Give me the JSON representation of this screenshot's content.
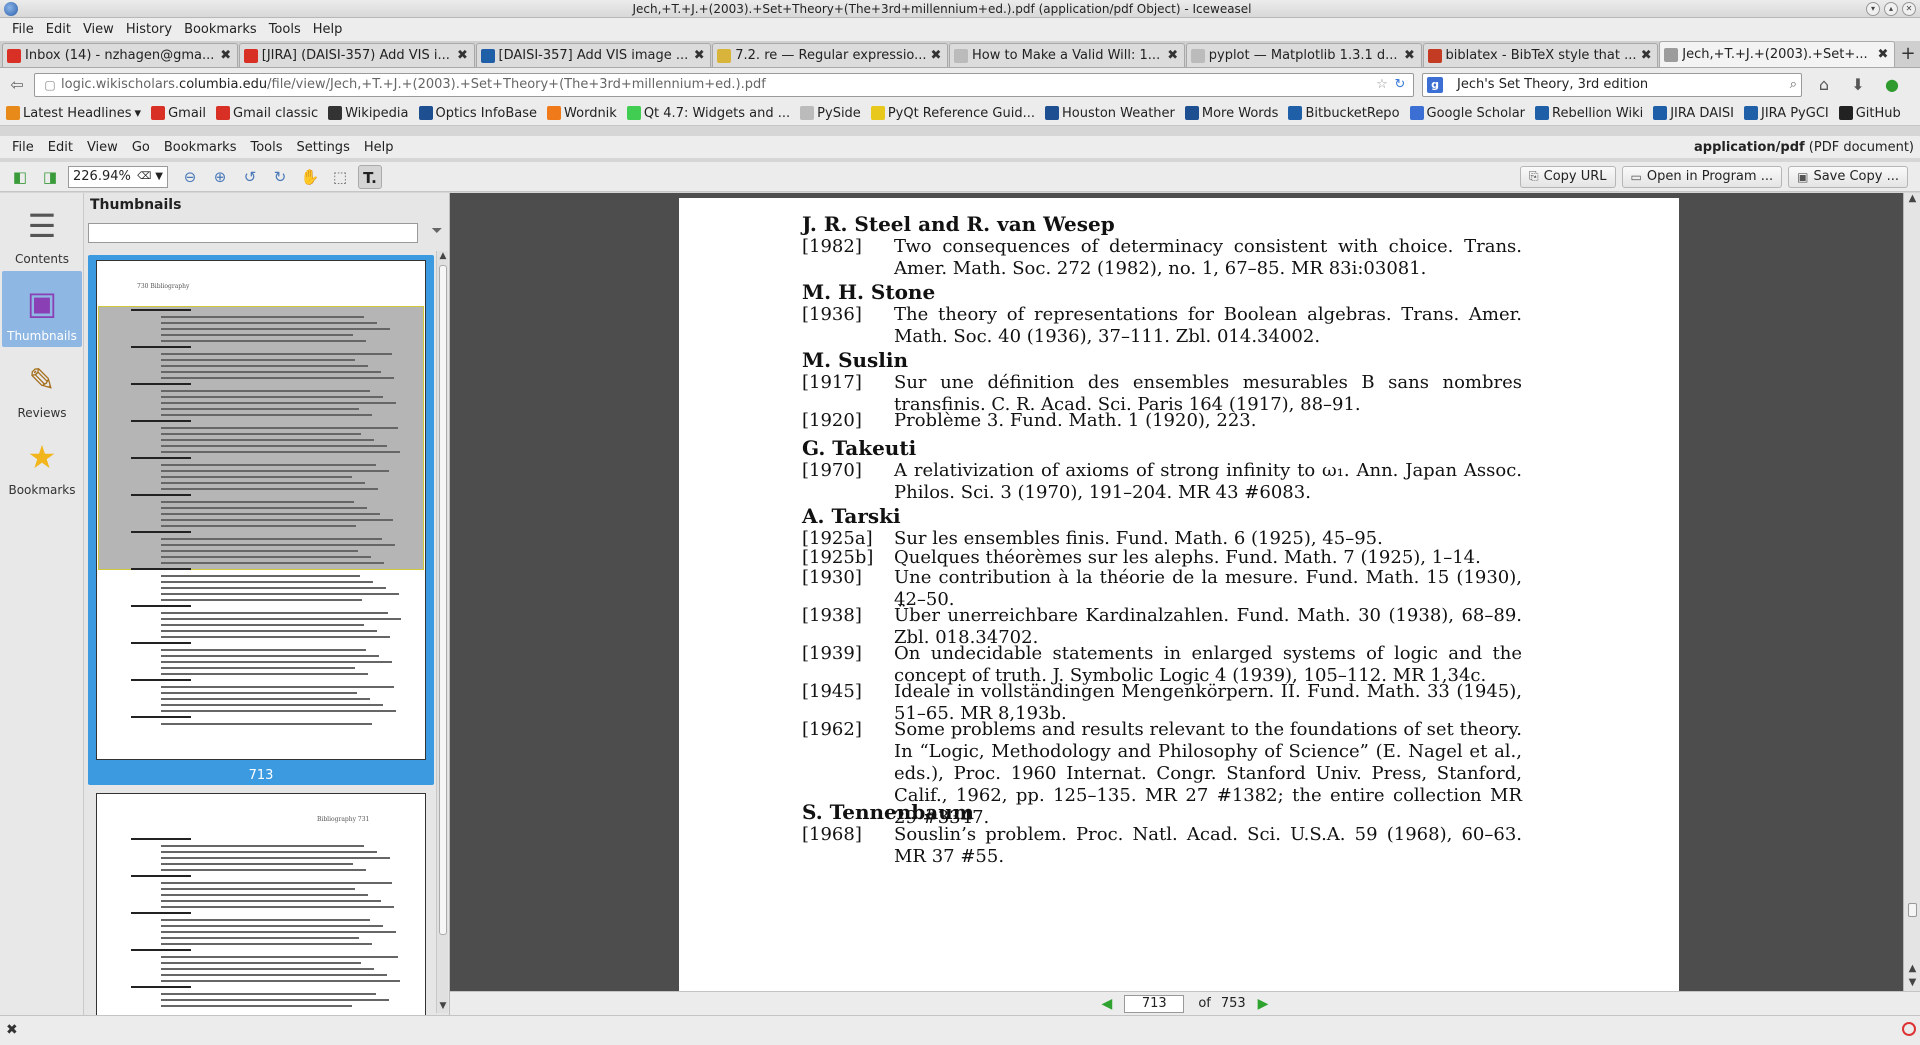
{
  "window": {
    "title": "Jech,+T.+J.+(2003).+Set+Theory+(The+3rd+millennium+ed.).pdf (application/pdf Object) - Iceweasel"
  },
  "menubar": [
    "File",
    "Edit",
    "View",
    "History",
    "Bookmarks",
    "Tools",
    "Help"
  ],
  "tabs": [
    {
      "label": "Inbox (14) - nzhagen@gma...",
      "icon": "gmail-icon",
      "color": "#d93025"
    },
    {
      "label": "[JIRA] (DAISI-357) Add VIS i...",
      "icon": "gmail-icon",
      "color": "#d93025"
    },
    {
      "label": "[DAISI-357] Add VIS image ...",
      "icon": "jira-icon",
      "color": "#1f5fa8"
    },
    {
      "label": "7.2. re — Regular expressio...",
      "icon": "python-icon",
      "color": "#d8b43a"
    },
    {
      "label": "How to Make a Valid Will: 1...",
      "icon": "page-icon",
      "color": "#bbbbbb"
    },
    {
      "label": "pyplot — Matplotlib 1.3.1 d...",
      "icon": "page-icon",
      "color": "#bbbbbb"
    },
    {
      "label": "biblatex - BibTeX style that ...",
      "icon": "stackexchange-icon",
      "color": "#c23b22"
    },
    {
      "label": "Jech,+T.+J.+(2003).+Set+...",
      "icon": "pdf-icon",
      "color": "#9c9c9c",
      "active": true
    }
  ],
  "navbar": {
    "url_prefix": "logic.wikischolars.",
    "url_host": "columbia.edu",
    "url_path": "/file/view/Jech,+T.+J.+(2003).+Set+Theory+(The+3rd+millennium+ed.).pdf",
    "search_value": "Jech's Set Theory, 3rd edition"
  },
  "bookmarks": [
    {
      "label": "Latest Headlines",
      "icon": "rss-icon",
      "color": "#e88a1a",
      "dropdown": true
    },
    {
      "label": "Gmail",
      "icon": "gmail-icon",
      "color": "#d93025"
    },
    {
      "label": "Gmail classic",
      "icon": "gmail-icon",
      "color": "#d93025"
    },
    {
      "label": "Wikipedia",
      "icon": "wikipedia-icon",
      "color": "#333333"
    },
    {
      "label": "Optics InfoBase",
      "icon": "osa-icon",
      "color": "#1d4f91"
    },
    {
      "label": "Wordnik",
      "icon": "heart-icon",
      "color": "#f07a1a"
    },
    {
      "label": "Qt 4.7: Widgets and ...",
      "icon": "qt-icon",
      "color": "#41cd52"
    },
    {
      "label": "PySide",
      "icon": "page-icon",
      "color": "#bbbbbb"
    },
    {
      "label": "PyQt Reference Guid...",
      "icon": "pyqt-icon",
      "color": "#e8c81a"
    },
    {
      "label": "Houston Weather",
      "icon": "weather-icon",
      "color": "#1d4f91"
    },
    {
      "label": "More Words",
      "icon": "words-icon",
      "color": "#1d4f91"
    },
    {
      "label": "BitbucketRepo",
      "icon": "bitbucket-icon",
      "color": "#1f5fa8"
    },
    {
      "label": "Google Scholar",
      "icon": "scholar-icon",
      "color": "#3b6fd3"
    },
    {
      "label": "Rebellion Wiki",
      "icon": "jira-icon",
      "color": "#1f5fa8"
    },
    {
      "label": "JIRA DAISI",
      "icon": "jira-icon",
      "color": "#1f5fa8"
    },
    {
      "label": "JIRA PyGCI",
      "icon": "jira-icon",
      "color": "#1f5fa8"
    },
    {
      "label": "GitHub",
      "icon": "github-icon",
      "color": "#222222"
    }
  ],
  "pdf_menu": [
    "File",
    "Edit",
    "View",
    "Go",
    "Bookmarks",
    "Tools",
    "Settings",
    "Help"
  ],
  "mimetype": {
    "type": "application/pdf",
    "desc": " (PDF document)"
  },
  "toolbar": {
    "zoom": "226.94%",
    "copy_url": "Copy URL",
    "open_in": "Open in Program ...",
    "save_copy": "Save Copy ..."
  },
  "sidebar": [
    {
      "label": "Contents",
      "icon": "contents-icon"
    },
    {
      "label": "Thumbnails",
      "icon": "thumbnails-icon",
      "active": true
    },
    {
      "label": "Reviews",
      "icon": "pencil-icon"
    },
    {
      "label": "Bookmarks",
      "icon": "star-icon"
    }
  ],
  "thumbnails": {
    "title": "Thumbnails",
    "active_page": "713",
    "header_left": "730       Bibliography",
    "second_header": "Bibliography       731"
  },
  "document": {
    "entries": [
      {
        "author": "J. R. Steel and R. van Wesep",
        "refs": [
          {
            "year": "[1982]",
            "text": "Two consequences of determinacy consistent with choice. Trans. Amer. Math. Soc. 272 (1982), no. 1, 67–85. MR 83i:03081."
          }
        ]
      },
      {
        "author": "M. H. Stone",
        "refs": [
          {
            "year": "[1936]",
            "text": "The theory of representations for Boolean algebras. Trans. Amer. Math. Soc. 40 (1936), 37–111. Zbl. 014.34002."
          }
        ]
      },
      {
        "author": "M. Suslin",
        "refs": [
          {
            "year": "[1917]",
            "text": "Sur une définition des ensembles mesurables B sans nombres transfinis. C. R. Acad. Sci. Paris 164 (1917), 88–91."
          },
          {
            "year": "[1920]",
            "text": "Problème 3. Fund. Math. 1 (1920), 223."
          }
        ]
      },
      {
        "author": "G. Takeuti",
        "refs": [
          {
            "year": "[1970]",
            "text": "A relativization of axioms of strong infinity to ω₁. Ann. Japan Assoc. Philos. Sci. 3 (1970), 191–204. MR 43 #6083."
          }
        ]
      },
      {
        "author": "A. Tarski",
        "refs": [
          {
            "year": "[1925a]",
            "text": "Sur les ensembles finis. Fund. Math. 6 (1925), 45–95."
          },
          {
            "year": "[1925b]",
            "text": "Quelques théorèmes sur les alephs. Fund. Math. 7 (1925), 1–14."
          },
          {
            "year": "[1930]",
            "text": "Une contribution à la théorie de la mesure. Fund. Math. 15 (1930), 42–50."
          },
          {
            "year": "[1938]",
            "text": "Über unerreichbare Kardinalzahlen. Fund. Math. 30 (1938), 68–89. Zbl. 018.34702."
          },
          {
            "year": "[1939]",
            "text": "On undecidable statements in enlarged systems of logic and the concept of truth. J. Symbolic Logic 4 (1939), 105–112. MR 1,34c."
          },
          {
            "year": "[1945]",
            "text": "Ideale in vollständingen Mengenkörpern. II. Fund. Math. 33 (1945), 51–65. MR 8,193b."
          },
          {
            "year": "[1962]",
            "text": "Some problems and results relevant to the foundations of set theory. In “Logic, Methodology and Philosophy of Science” (E. Nagel et al., eds.), Proc. 1960 Internat. Congr. Stanford Univ. Press, Stanford, Calif., 1962, pp. 125–135. MR 27 #1382; the entire collection MR 29 #3347."
          }
        ]
      },
      {
        "author": "S. Tennenbaum",
        "refs": [
          {
            "year": "[1968]",
            "text": "Souslin’s problem. Proc. Natl. Acad. Sci. U.S.A. 59 (1968), 60–63. MR 37 #55."
          }
        ]
      }
    ]
  },
  "pagenav": {
    "current": "713",
    "of": "of",
    "total": "753"
  }
}
